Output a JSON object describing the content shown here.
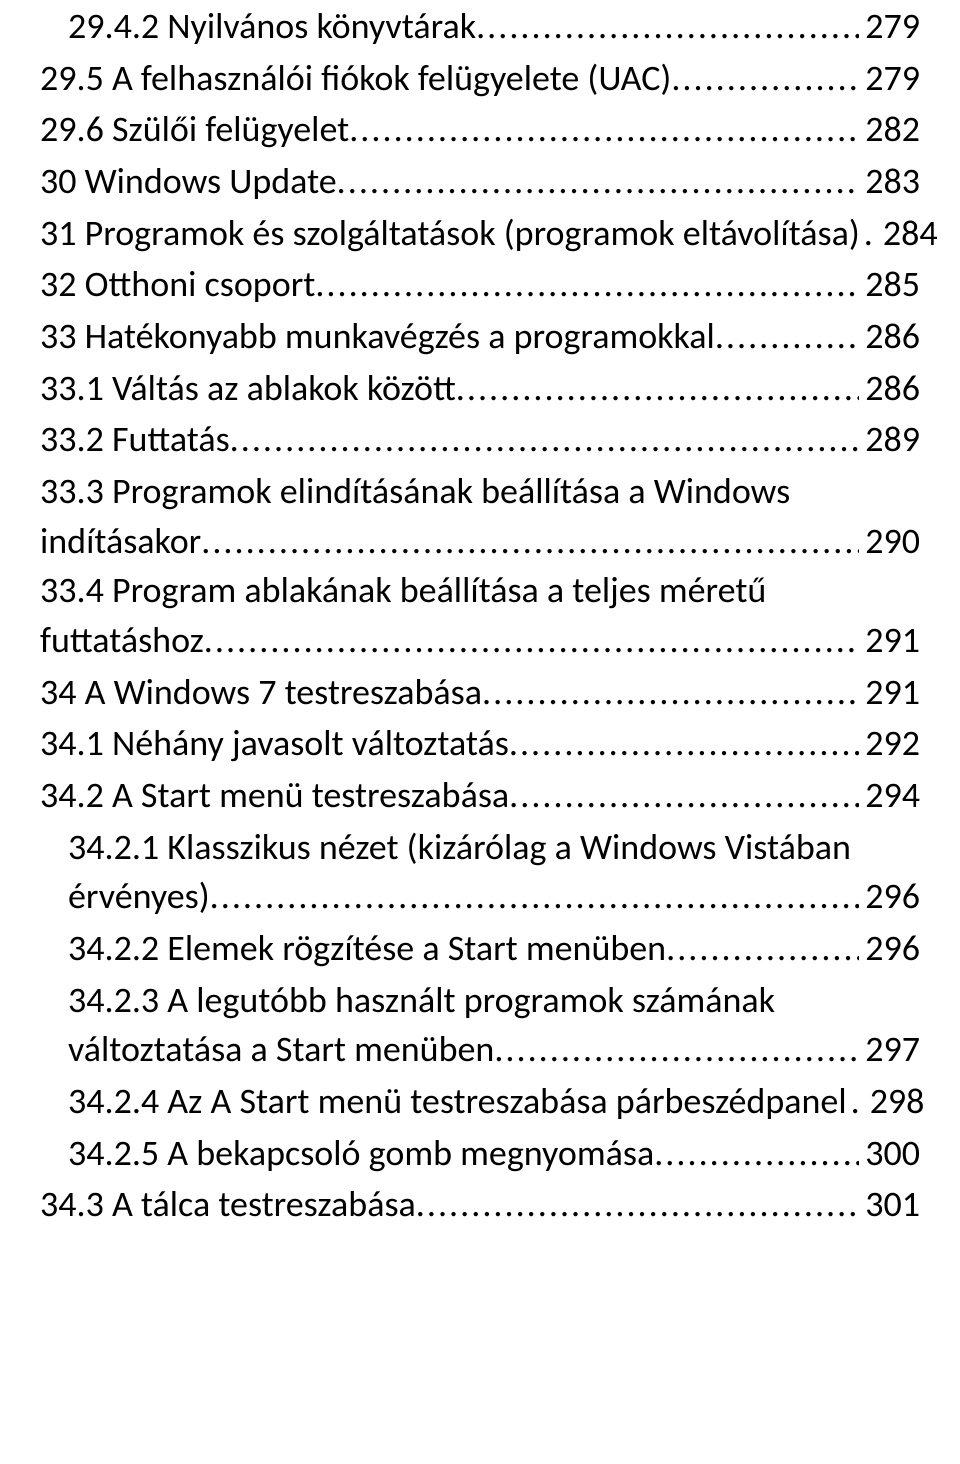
{
  "entries": [
    {
      "indent": 1,
      "text": "29.4.2 Nyilvános könyvtárak",
      "page": "279",
      "multi": false,
      "dotspace": true
    },
    {
      "indent": 0,
      "text": "29.5 A felhasználói fiókok felügyelete (UAC)",
      "page": "279",
      "multi": false,
      "dotspace": true
    },
    {
      "indent": 0,
      "text": "29.6 Szülői felügyelet",
      "page": "282",
      "multi": false,
      "dotspace": true
    },
    {
      "indent": 0,
      "text": "30 Windows Update",
      "page": "283",
      "multi": false,
      "dotspace": true
    },
    {
      "indent": 0,
      "text": "31 Programok és szolgáltatások (programok eltávolítása)",
      "page": "284",
      "multi": false,
      "dotspace": false,
      "nodots": true,
      "sep": ". "
    },
    {
      "indent": 0,
      "text": "32 Otthoni csoport",
      "page": "285",
      "multi": false,
      "dotspace": true
    },
    {
      "indent": 0,
      "text": "33 Hatékonyabb munkavégzés a programokkal",
      "page": "286",
      "multi": false,
      "dotspace": true
    },
    {
      "indent": 0,
      "text": "33.1 Váltás az ablakok között",
      "page": "286",
      "multi": false,
      "dotspace": true
    },
    {
      "indent": 0,
      "text": "33.2 Futtatás",
      "page": "289",
      "multi": false,
      "dotspace": true
    },
    {
      "indent": 0,
      "text_first": "33.3 Programok elindításának beállítása a Windows",
      "text_last": "indításakor",
      "page": "290",
      "multi": true,
      "dotspace": true
    },
    {
      "indent": 0,
      "text_first": "33.4 Program ablakának beállítása a teljes méretű",
      "text_last": "futtatáshoz",
      "page": "291",
      "multi": true,
      "dotspace": true
    },
    {
      "indent": 0,
      "text": "34 A Windows 7 testreszabása",
      "page": "291",
      "multi": false,
      "dotspace": true
    },
    {
      "indent": 0,
      "text": "34.1 Néhány javasolt változtatás",
      "page": "292",
      "multi": false,
      "dotspace": true
    },
    {
      "indent": 0,
      "text": "34.2 A Start menü testreszabása",
      "page": "294",
      "multi": false,
      "dotspace": true
    },
    {
      "indent": 1,
      "text_first": "34.2.1 Klasszikus nézet (kizárólag a Windows Vistában",
      "text_last": "érvényes)",
      "page": "296",
      "multi": true,
      "dotspace": true
    },
    {
      "indent": 1,
      "text": "34.2.2 Elemek rögzítése a Start menüben",
      "page": "296",
      "multi": false,
      "dotspace": true
    },
    {
      "indent": 1,
      "text_first": "34.2.3 A legutóbb használt programok számának",
      "text_last": "változtatása a Start menüben",
      "page": "297",
      "multi": true,
      "dotspace": true
    },
    {
      "indent": 1,
      "text": "34.2.4 Az A Start menü testreszabása párbeszédpanel",
      "page": "298",
      "multi": false,
      "dotspace": false,
      "nodots": true,
      "sep": " . "
    },
    {
      "indent": 1,
      "text": "34.2.5 A bekapcsoló gomb megnyomása",
      "page": "300",
      "multi": false,
      "dotspace": true
    },
    {
      "indent": 0,
      "text": "34.3 A tálca testreszabása",
      "page": "301",
      "multi": false,
      "dotspace": true
    }
  ]
}
